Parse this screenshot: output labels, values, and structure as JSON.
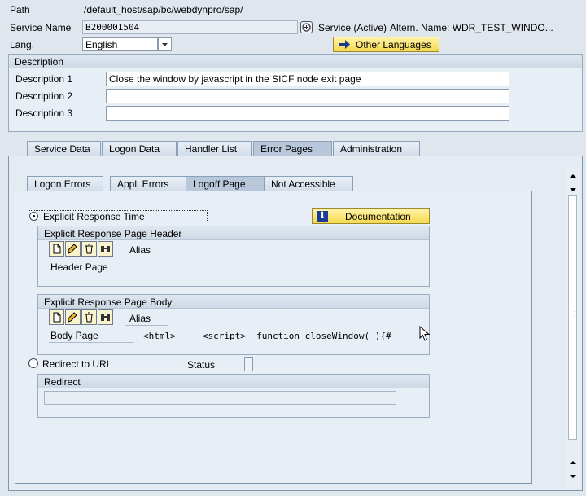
{
  "header": {
    "path_label": "Path",
    "path_value": "/default_host/sap/bc/webdynpro/sap/",
    "service_name_label": "Service Name",
    "service_name_value": "B200001504",
    "service_status": "Service (Active)",
    "altern_name": "Altern. Name: WDR_TEST_WINDO...",
    "lang_label": "Lang.",
    "lang_value": "English",
    "other_languages_label": "Other Languages"
  },
  "description": {
    "title": "Description",
    "rows": [
      {
        "label": "Description 1",
        "value": "Close the window by javascript in the SICF node exit page"
      },
      {
        "label": "Description 2",
        "value": ""
      },
      {
        "label": "Description 3",
        "value": ""
      }
    ]
  },
  "main_tabs": [
    {
      "label": "Service Data"
    },
    {
      "label": "Logon Data"
    },
    {
      "label": "Handler List"
    },
    {
      "label": "Error Pages"
    },
    {
      "label": "Administration"
    }
  ],
  "main_tabs_active": "Error Pages",
  "sub_tabs": [
    {
      "label": "Logon Errors"
    },
    {
      "label": "Appl. Errors"
    },
    {
      "label": "Logoff Page"
    },
    {
      "label": "Not Accessible"
    }
  ],
  "sub_tabs_active": "Logoff Page",
  "logoff": {
    "explicit_response_label": "Explicit Response Time",
    "explicit_response_selected": true,
    "documentation_label": "Documentation",
    "header_group": {
      "title": "Explicit Response Page Header",
      "alias_label": "Alias",
      "page_label": "Header Page"
    },
    "body_group": {
      "title": "Explicit Response Page Body",
      "alias_label": "Alias",
      "page_label": "Body Page",
      "page_content": "<html>     <script>  function closeWindow( ){#"
    },
    "redirect_label": "Redirect to URL",
    "redirect_selected": false,
    "status_label": "Status",
    "redirect_group": {
      "title": "Redirect"
    }
  },
  "icons": {
    "possible_entries": "value-help-icon",
    "arrow": "arrow-right-icon",
    "info": "info-icon",
    "create": "create-icon",
    "change": "change-pencil-icon",
    "delete": "delete-trash-icon",
    "display": "display-binoculars-icon",
    "cursor": "mouse-cursor"
  },
  "colors": {
    "background": "#dfe6ee",
    "button_yellow": "#f6d94d",
    "active_tab": "#b8c8da"
  }
}
